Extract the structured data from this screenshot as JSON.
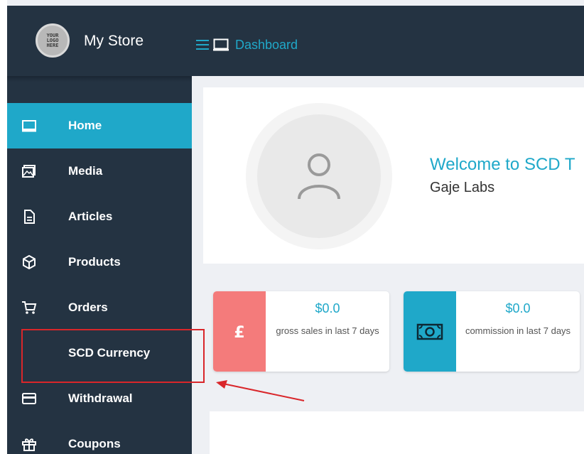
{
  "header": {
    "logo_lines": [
      "YOUR",
      "LOGO",
      "HERE"
    ],
    "store_name": "My Store",
    "breadcrumb": "Dashboard"
  },
  "sidebar": {
    "items": [
      {
        "label": "Home",
        "icon": "monitor-icon",
        "active": true
      },
      {
        "label": "Media",
        "icon": "image-icon"
      },
      {
        "label": "Articles",
        "icon": "document-icon"
      },
      {
        "label": "Products",
        "icon": "cube-icon"
      },
      {
        "label": "Orders",
        "icon": "cart-icon"
      },
      {
        "label": "SCD Currency",
        "icon": ""
      },
      {
        "label": "Withdrawal",
        "icon": "card-icon"
      },
      {
        "label": "Coupons",
        "icon": "gift-icon"
      }
    ]
  },
  "profile": {
    "welcome": "Welcome to SCD T",
    "company": "Gaje Labs"
  },
  "stats": [
    {
      "value": "$0.0",
      "label": "gross sales in last 7 days",
      "icon": "pound-icon",
      "color": "#f47b7b"
    },
    {
      "value": "$0.0",
      "label": "commission in last 7 days",
      "icon": "money-icon",
      "color": "#1fa8c9"
    }
  ],
  "colors": {
    "sidebar_bg": "#243342",
    "accent": "#1fa8c9",
    "annotation": "#d9262a"
  }
}
